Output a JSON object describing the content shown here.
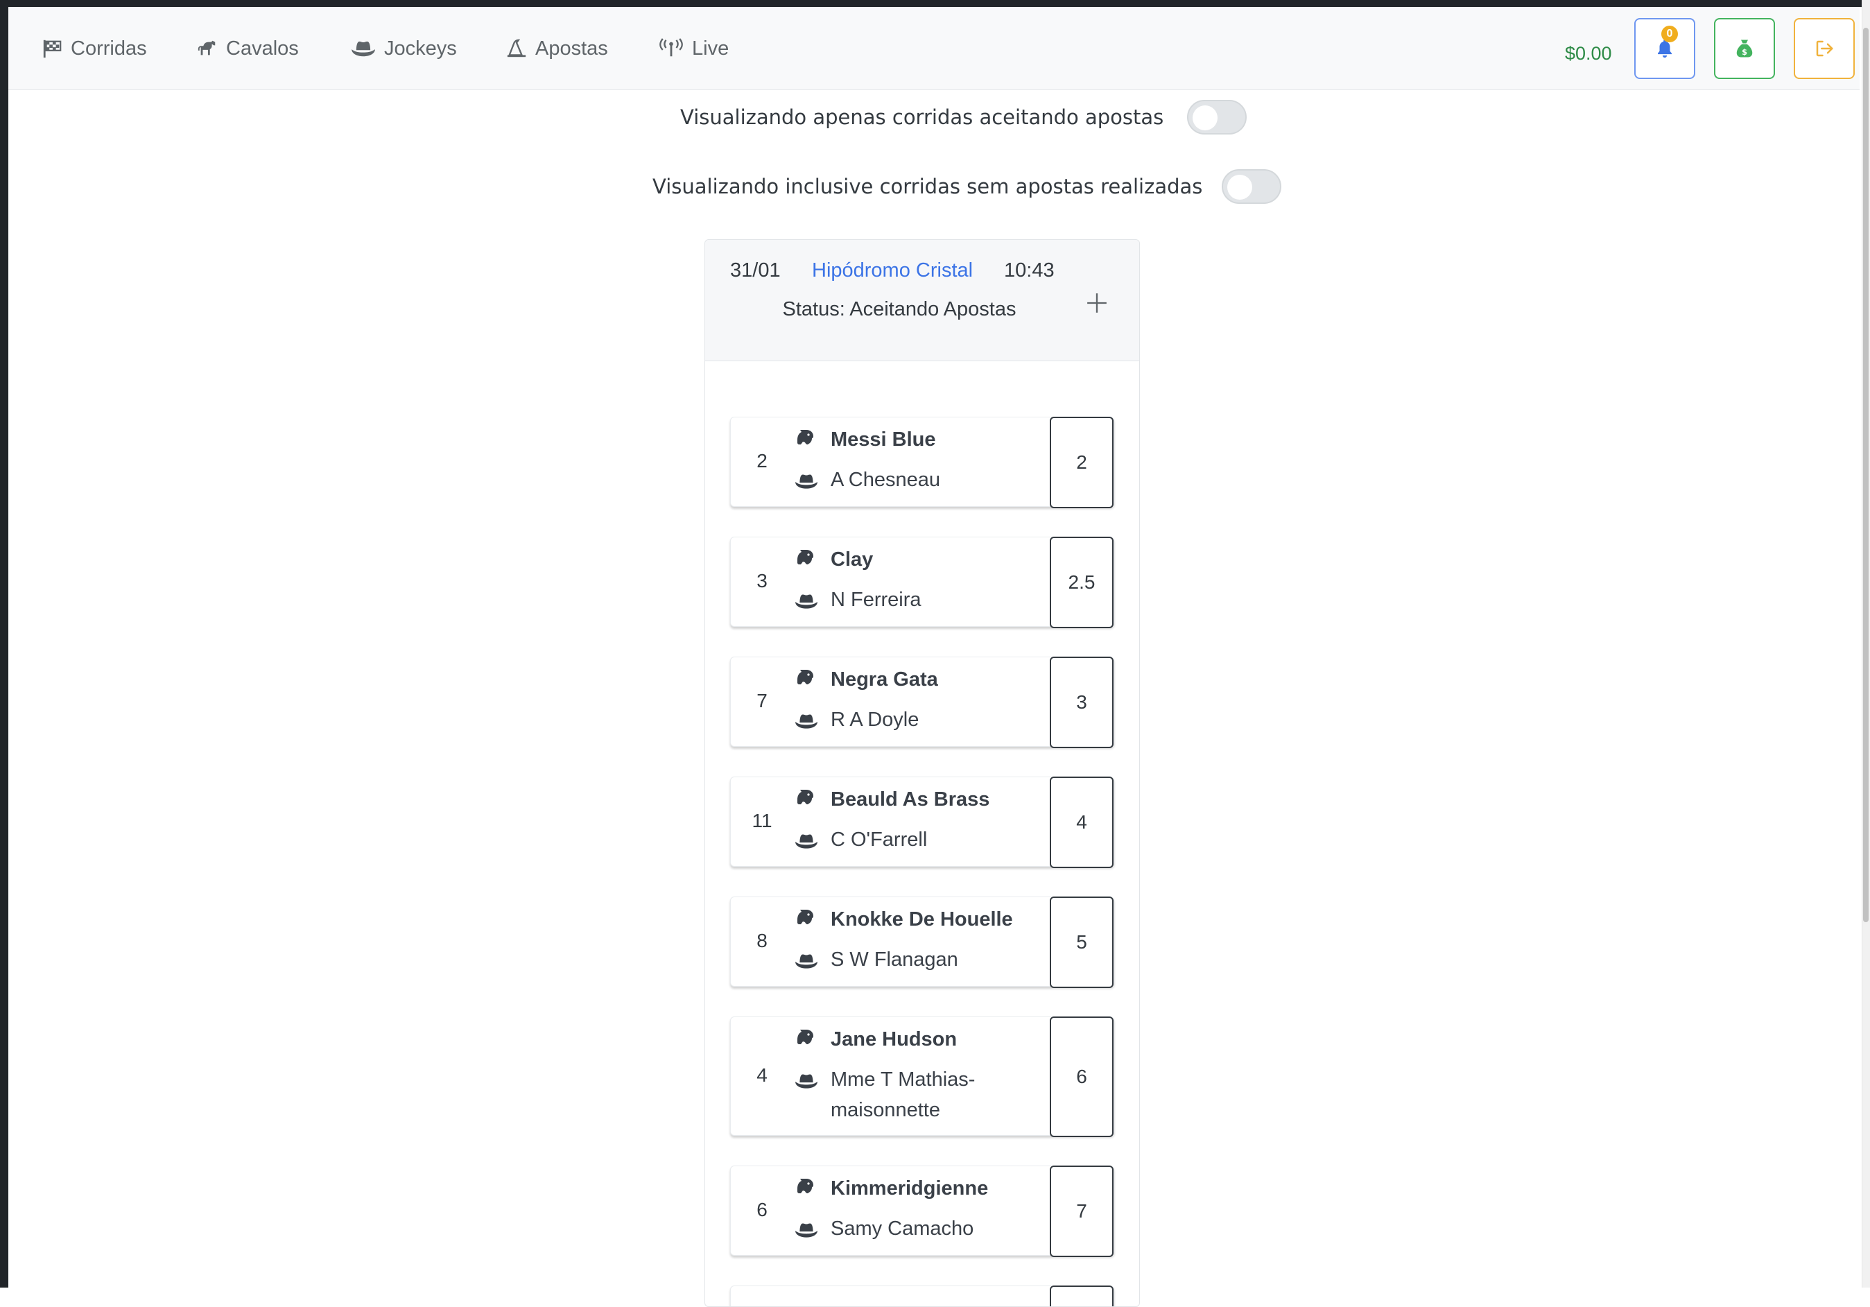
{
  "nav": {
    "items": [
      {
        "label": "Corridas",
        "icon": "checkered-flag-icon"
      },
      {
        "label": "Cavalos",
        "icon": "horse-icon"
      },
      {
        "label": "Jockeys",
        "icon": "hat-cowboy-icon"
      },
      {
        "label": "Apostas",
        "icon": "wizard-hat-icon"
      },
      {
        "label": "Live",
        "icon": "broadcast-tower-icon"
      }
    ],
    "balance": "$0.00",
    "notification_count": "0"
  },
  "filters": {
    "accepting_bets_label": "Visualizando apenas corridas aceitando apostas",
    "without_bets_label": "Visualizando inclusive corridas sem apostas realizadas"
  },
  "race": {
    "date": "31/01",
    "track": "Hipódromo Cristal",
    "time": "10:43",
    "status": "Status: Aceitando Apostas",
    "runners": [
      {
        "number": "2",
        "horse": "Messi Blue",
        "jockey": "A Chesneau",
        "odds": "2"
      },
      {
        "number": "3",
        "horse": "Clay",
        "jockey": "N Ferreira",
        "odds": "2.5"
      },
      {
        "number": "7",
        "horse": "Negra Gata",
        "jockey": "R A Doyle",
        "odds": "3"
      },
      {
        "number": "11",
        "horse": "Beauld As Brass",
        "jockey": "C O'Farrell",
        "odds": "4"
      },
      {
        "number": "8",
        "horse": "Knokke De Houelle",
        "jockey": "S W Flanagan",
        "odds": "5"
      },
      {
        "number": "4",
        "horse": "Jane Hudson",
        "jockey": "Mme T Mathias-maisonnette",
        "odds": "6"
      },
      {
        "number": "6",
        "horse": "Kimmeridgienne",
        "jockey": "Samy Camacho",
        "odds": "7"
      }
    ]
  },
  "colors": {
    "balance": "#2e8b47",
    "link": "#3c74e6",
    "bell_border": "#6f97f0",
    "money_border": "#43b35e",
    "logout_border": "#f0b23c"
  }
}
